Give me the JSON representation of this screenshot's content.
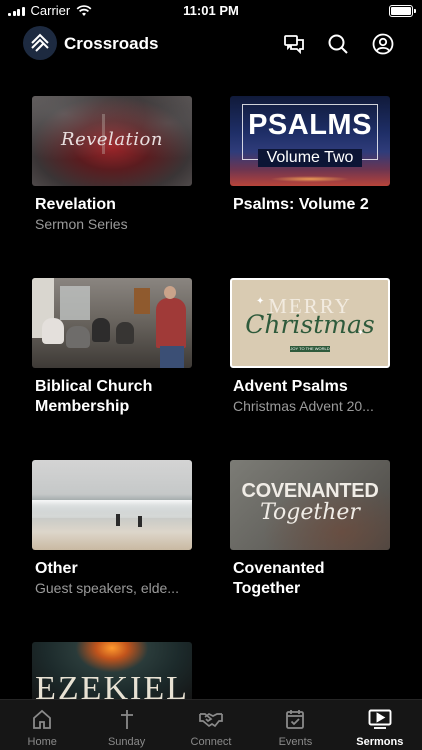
{
  "status": {
    "carrier": "Carrier",
    "time": "11:01 PM"
  },
  "header": {
    "brand": "Crossroads"
  },
  "series": [
    {
      "title": "Revelation",
      "subtitle": "Sermon Series",
      "art_text": "Revelation"
    },
    {
      "title": "Psalms: Volume 2",
      "subtitle": "",
      "art_line1": "PSALMS",
      "art_line2": "Volume Two"
    },
    {
      "title": "Biblical Church Membership",
      "subtitle": ""
    },
    {
      "title": "Advent Psalms",
      "subtitle": "Christmas Advent 20...",
      "art_merry": "MERRY",
      "art_christmas": "Christmas",
      "art_small": "JOY TO THE WORLD"
    },
    {
      "title": "Other",
      "subtitle": "Guest speakers, elde..."
    },
    {
      "title": "Covenanted Together",
      "subtitle": "",
      "art_line1": "COVENANTED",
      "art_line2": "Together"
    },
    {
      "title": "",
      "subtitle": "",
      "art_text": "EZEKIEL"
    }
  ],
  "tabs": [
    {
      "label": "Home",
      "icon": "home-icon",
      "active": false
    },
    {
      "label": "Sunday",
      "icon": "cross-icon",
      "active": false
    },
    {
      "label": "Connect",
      "icon": "handshake-icon",
      "active": false
    },
    {
      "label": "Events",
      "icon": "calendar-icon",
      "active": false
    },
    {
      "label": "Sermons",
      "icon": "play-screen-icon",
      "active": true
    }
  ]
}
